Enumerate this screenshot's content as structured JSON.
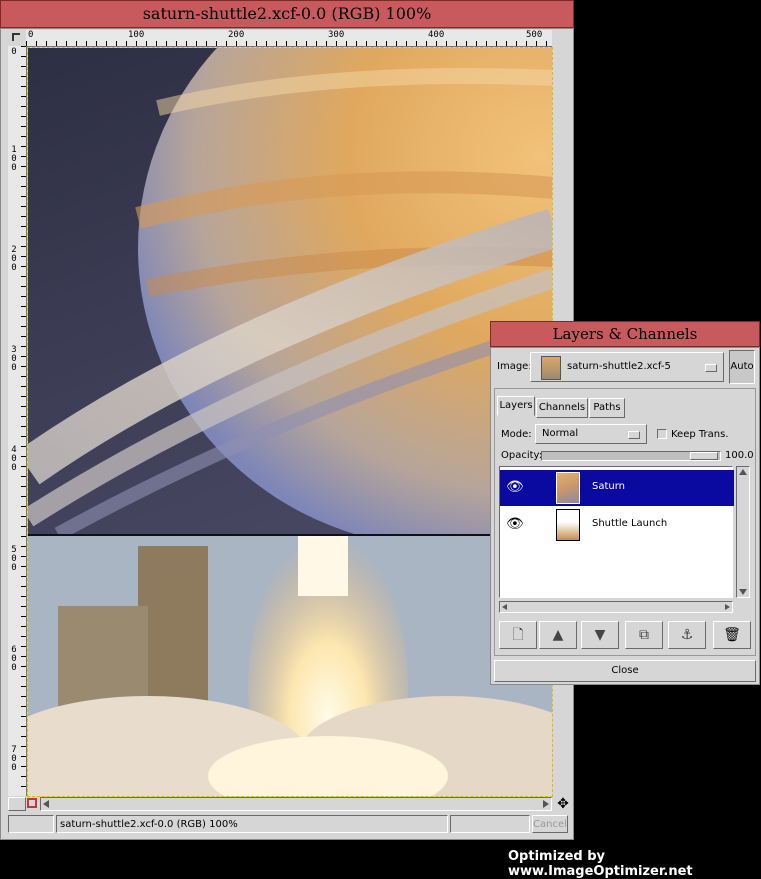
{
  "image_window": {
    "title": "saturn-shuttle2.xcf-0.0 (RGB) 100%",
    "ruler_top_labels": [
      "0",
      "100",
      "200",
      "300",
      "400",
      "500"
    ],
    "ruler_left_labels": [
      "0",
      "100",
      "200",
      "300",
      "400",
      "500",
      "600",
      "700"
    ],
    "status_text": "saturn-shuttle2.xcf-0.0 (RGB) 100%",
    "cancel_label": "Cancel",
    "quick_mask_icon": "quick-mask-icon",
    "navigate_icon": "navigate-icon"
  },
  "layers_dialog": {
    "title": "Layers & Channels",
    "image_label": "Image:",
    "image_value": "saturn-shuttle2.xcf-5",
    "auto_label": "Auto",
    "tabs": [
      {
        "label": "Layers"
      },
      {
        "label": "Channels"
      },
      {
        "label": "Paths"
      }
    ],
    "mode_label": "Mode:",
    "mode_value": "Normal",
    "keep_trans_label": "Keep Trans.",
    "opacity_label": "Opacity:",
    "opacity_value": "100.0",
    "layers": [
      {
        "name": "Saturn",
        "selected": true,
        "visible": true
      },
      {
        "name": "Shuttle Launch",
        "selected": false,
        "visible": true
      }
    ],
    "buttons": [
      {
        "name": "new-layer-icon"
      },
      {
        "name": "raise-layer-icon"
      },
      {
        "name": "lower-layer-icon"
      },
      {
        "name": "duplicate-layer-icon"
      },
      {
        "name": "anchor-layer-icon"
      },
      {
        "name": "delete-layer-icon"
      }
    ],
    "close_label": "Close"
  },
  "footer": {
    "text": "Optimized by www.ImageOptimizer.net"
  },
  "colors": {
    "title_bar": "#c85a5e",
    "selection": "#0a0aa0",
    "window_bg": "#d6d6d6"
  }
}
